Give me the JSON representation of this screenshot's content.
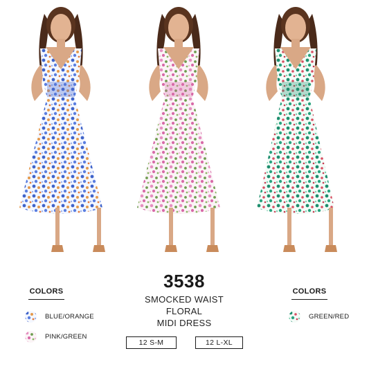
{
  "product": {
    "style_number": "3538",
    "title_lines": [
      "SMOCKED WAIST",
      "FLORAL",
      "MIDI DRESS"
    ],
    "sizes": [
      "12 S-M",
      "12 L-XL"
    ]
  },
  "colors_left": {
    "heading": "COLORS",
    "items": [
      {
        "label": "BLUE/ORANGE",
        "swatch_icon": "blue-orange-floral-swatch"
      },
      {
        "label": "PINK/GREEN",
        "swatch_icon": "pink-green-floral-swatch"
      }
    ]
  },
  "colors_right": {
    "heading": "COLORS",
    "items": [
      {
        "label": "GREEN/RED",
        "swatch_icon": "green-red-floral-swatch"
      }
    ]
  },
  "palette": {
    "blue_orange": [
      "#3f63c9",
      "#e59a4b",
      "#ffffff"
    ],
    "pink_green": [
      "#e58fc0",
      "#6d9d4f",
      "#ffffff"
    ],
    "green_red": [
      "#1e8e6e",
      "#d94f62",
      "#ffffff"
    ]
  }
}
